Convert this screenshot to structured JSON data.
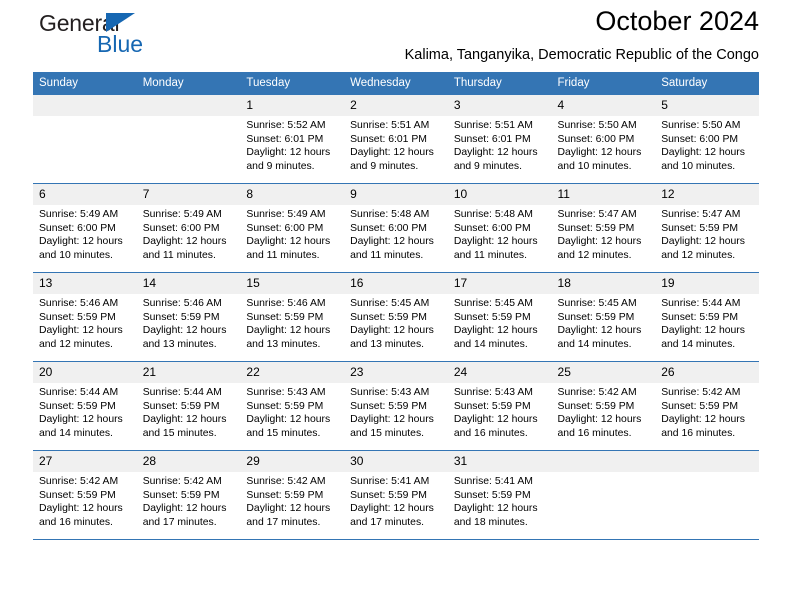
{
  "brand": {
    "name_part1": "General",
    "name_part2": "Blue",
    "accent_color": "#1667b2"
  },
  "header": {
    "title": "October 2024",
    "subtitle": "Kalima, Tanganyika, Democratic Republic of the Congo"
  },
  "calendar": {
    "header_bg": "#3475b4",
    "weekdays": [
      "Sunday",
      "Monday",
      "Tuesday",
      "Wednesday",
      "Thursday",
      "Friday",
      "Saturday"
    ],
    "weeks": [
      [
        {
          "date": "",
          "sunrise": "",
          "sunset": "",
          "daylight": ""
        },
        {
          "date": "",
          "sunrise": "",
          "sunset": "",
          "daylight": ""
        },
        {
          "date": "1",
          "sunrise": "Sunrise: 5:52 AM",
          "sunset": "Sunset: 6:01 PM",
          "daylight": "Daylight: 12 hours and 9 minutes."
        },
        {
          "date": "2",
          "sunrise": "Sunrise: 5:51 AM",
          "sunset": "Sunset: 6:01 PM",
          "daylight": "Daylight: 12 hours and 9 minutes."
        },
        {
          "date": "3",
          "sunrise": "Sunrise: 5:51 AM",
          "sunset": "Sunset: 6:01 PM",
          "daylight": "Daylight: 12 hours and 9 minutes."
        },
        {
          "date": "4",
          "sunrise": "Sunrise: 5:50 AM",
          "sunset": "Sunset: 6:00 PM",
          "daylight": "Daylight: 12 hours and 10 minutes."
        },
        {
          "date": "5",
          "sunrise": "Sunrise: 5:50 AM",
          "sunset": "Sunset: 6:00 PM",
          "daylight": "Daylight: 12 hours and 10 minutes."
        }
      ],
      [
        {
          "date": "6",
          "sunrise": "Sunrise: 5:49 AM",
          "sunset": "Sunset: 6:00 PM",
          "daylight": "Daylight: 12 hours and 10 minutes."
        },
        {
          "date": "7",
          "sunrise": "Sunrise: 5:49 AM",
          "sunset": "Sunset: 6:00 PM",
          "daylight": "Daylight: 12 hours and 11 minutes."
        },
        {
          "date": "8",
          "sunrise": "Sunrise: 5:49 AM",
          "sunset": "Sunset: 6:00 PM",
          "daylight": "Daylight: 12 hours and 11 minutes."
        },
        {
          "date": "9",
          "sunrise": "Sunrise: 5:48 AM",
          "sunset": "Sunset: 6:00 PM",
          "daylight": "Daylight: 12 hours and 11 minutes."
        },
        {
          "date": "10",
          "sunrise": "Sunrise: 5:48 AM",
          "sunset": "Sunset: 6:00 PM",
          "daylight": "Daylight: 12 hours and 11 minutes."
        },
        {
          "date": "11",
          "sunrise": "Sunrise: 5:47 AM",
          "sunset": "Sunset: 5:59 PM",
          "daylight": "Daylight: 12 hours and 12 minutes."
        },
        {
          "date": "12",
          "sunrise": "Sunrise: 5:47 AM",
          "sunset": "Sunset: 5:59 PM",
          "daylight": "Daylight: 12 hours and 12 minutes."
        }
      ],
      [
        {
          "date": "13",
          "sunrise": "Sunrise: 5:46 AM",
          "sunset": "Sunset: 5:59 PM",
          "daylight": "Daylight: 12 hours and 12 minutes."
        },
        {
          "date": "14",
          "sunrise": "Sunrise: 5:46 AM",
          "sunset": "Sunset: 5:59 PM",
          "daylight": "Daylight: 12 hours and 13 minutes."
        },
        {
          "date": "15",
          "sunrise": "Sunrise: 5:46 AM",
          "sunset": "Sunset: 5:59 PM",
          "daylight": "Daylight: 12 hours and 13 minutes."
        },
        {
          "date": "16",
          "sunrise": "Sunrise: 5:45 AM",
          "sunset": "Sunset: 5:59 PM",
          "daylight": "Daylight: 12 hours and 13 minutes."
        },
        {
          "date": "17",
          "sunrise": "Sunrise: 5:45 AM",
          "sunset": "Sunset: 5:59 PM",
          "daylight": "Daylight: 12 hours and 14 minutes."
        },
        {
          "date": "18",
          "sunrise": "Sunrise: 5:45 AM",
          "sunset": "Sunset: 5:59 PM",
          "daylight": "Daylight: 12 hours and 14 minutes."
        },
        {
          "date": "19",
          "sunrise": "Sunrise: 5:44 AM",
          "sunset": "Sunset: 5:59 PM",
          "daylight": "Daylight: 12 hours and 14 minutes."
        }
      ],
      [
        {
          "date": "20",
          "sunrise": "Sunrise: 5:44 AM",
          "sunset": "Sunset: 5:59 PM",
          "daylight": "Daylight: 12 hours and 14 minutes."
        },
        {
          "date": "21",
          "sunrise": "Sunrise: 5:44 AM",
          "sunset": "Sunset: 5:59 PM",
          "daylight": "Daylight: 12 hours and 15 minutes."
        },
        {
          "date": "22",
          "sunrise": "Sunrise: 5:43 AM",
          "sunset": "Sunset: 5:59 PM",
          "daylight": "Daylight: 12 hours and 15 minutes."
        },
        {
          "date": "23",
          "sunrise": "Sunrise: 5:43 AM",
          "sunset": "Sunset: 5:59 PM",
          "daylight": "Daylight: 12 hours and 15 minutes."
        },
        {
          "date": "24",
          "sunrise": "Sunrise: 5:43 AM",
          "sunset": "Sunset: 5:59 PM",
          "daylight": "Daylight: 12 hours and 16 minutes."
        },
        {
          "date": "25",
          "sunrise": "Sunrise: 5:42 AM",
          "sunset": "Sunset: 5:59 PM",
          "daylight": "Daylight: 12 hours and 16 minutes."
        },
        {
          "date": "26",
          "sunrise": "Sunrise: 5:42 AM",
          "sunset": "Sunset: 5:59 PM",
          "daylight": "Daylight: 12 hours and 16 minutes."
        }
      ],
      [
        {
          "date": "27",
          "sunrise": "Sunrise: 5:42 AM",
          "sunset": "Sunset: 5:59 PM",
          "daylight": "Daylight: 12 hours and 16 minutes."
        },
        {
          "date": "28",
          "sunrise": "Sunrise: 5:42 AM",
          "sunset": "Sunset: 5:59 PM",
          "daylight": "Daylight: 12 hours and 17 minutes."
        },
        {
          "date": "29",
          "sunrise": "Sunrise: 5:42 AM",
          "sunset": "Sunset: 5:59 PM",
          "daylight": "Daylight: 12 hours and 17 minutes."
        },
        {
          "date": "30",
          "sunrise": "Sunrise: 5:41 AM",
          "sunset": "Sunset: 5:59 PM",
          "daylight": "Daylight: 12 hours and 17 minutes."
        },
        {
          "date": "31",
          "sunrise": "Sunrise: 5:41 AM",
          "sunset": "Sunset: 5:59 PM",
          "daylight": "Daylight: 12 hours and 18 minutes."
        },
        {
          "date": "",
          "sunrise": "",
          "sunset": "",
          "daylight": ""
        },
        {
          "date": "",
          "sunrise": "",
          "sunset": "",
          "daylight": ""
        }
      ]
    ]
  }
}
